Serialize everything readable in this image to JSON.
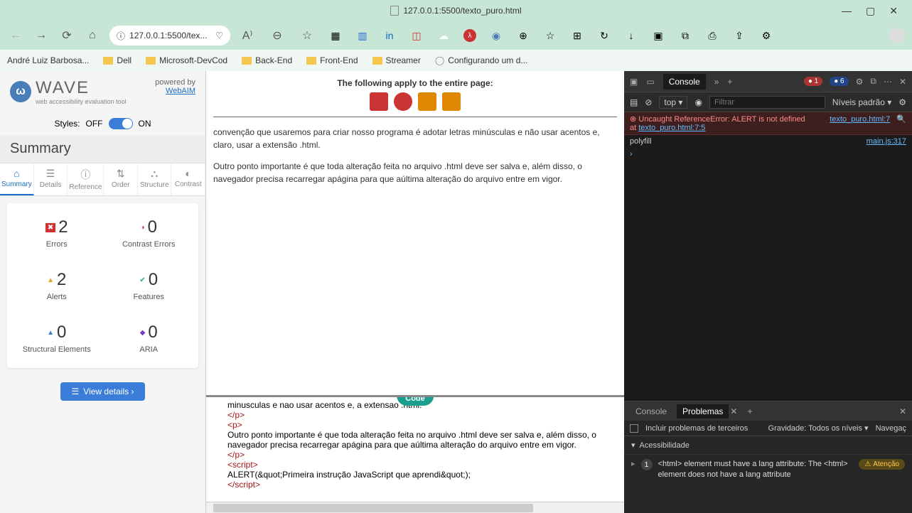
{
  "browser": {
    "tab_title": "127.0.0.1:5500/texto_puro.html",
    "address": "127.0.0.1:5500/tex...",
    "bookmarks": [
      {
        "label": "André Luiz Barbosa..."
      },
      {
        "label": "Dell"
      },
      {
        "label": "Microsoft-DevCod"
      },
      {
        "label": "Back-End"
      },
      {
        "label": "Front-End"
      },
      {
        "label": "Streamer"
      },
      {
        "label": "Configurando um d..."
      }
    ]
  },
  "wave": {
    "brand": "WAVE",
    "tagline": "web accessibility evaluation tool",
    "powered": "powered by",
    "powered_link": "WebAIM",
    "styles_label": "Styles:",
    "off": "OFF",
    "on": "ON",
    "summary": "Summary",
    "tabs": [
      "Summary",
      "Details",
      "Reference",
      "Order",
      "Structure",
      "Contrast"
    ],
    "stats": {
      "errors": {
        "n": "2",
        "l": "Errors",
        "color": "#c33",
        "glyph": "✖"
      },
      "contrast": {
        "n": "0",
        "l": "Contrast Errors",
        "color": "#c33",
        "glyph": "◑"
      },
      "alerts": {
        "n": "2",
        "l": "Alerts",
        "color": "#e6a817",
        "glyph": "▲"
      },
      "features": {
        "n": "0",
        "l": "Features",
        "color": "#2a7",
        "glyph": "✔"
      },
      "structural": {
        "n": "0",
        "l": "Structural Elements",
        "color": "#3b7dd8",
        "glyph": "▲"
      },
      "aria": {
        "n": "0",
        "l": "ARIA",
        "color": "#7a3bb8",
        "glyph": "◆"
      }
    },
    "view_details": "View details ›"
  },
  "page": {
    "banner": "The following apply to the entire page:",
    "p1": "convenção que usaremos para criar nosso programa é adotar letras minúsculas e não usar acentos e, claro, usar a extensão .html.",
    "p2": "Outro ponto importante é que toda alteração feita no arquivo .html deve ser salva e, além disso, o navegador precisa recarregar apágina para que aúltima alteração do arquivo entre em vigor."
  },
  "code": {
    "badge_top": "</>",
    "badge": "Code",
    "l1a": "minusculas e nao usar acentos e,",
    "l1b": " a extensao .ntml.",
    "l2": "</p>",
    "l3": "<p>",
    "l4": " Outro ponto importante é que toda alteração feita no arquivo .html deve ser salva e, além disso, o navegador precisa recarregar apágina para que aúltima alteração do arquivo entre em vigor.",
    "l5": "</p>",
    "l6": "<script>",
    "l7": " ALERT(&quot;Primeira instrução JavaScript que aprendi&quot;);",
    "l8": "</scr"
  },
  "devtools": {
    "tab_console": "Console",
    "err_badge": "1",
    "info_badge": "6",
    "context": "top",
    "filter_ph": "Filtrar",
    "levels": "Níveis padrão",
    "err_msg": "Uncaught ReferenceError: ALERT is not defined",
    "err_at": "    at ",
    "err_at_link": "texto_puro.html:7:5",
    "err_link": "texto_puro.html:7",
    "poly": "polyfill",
    "poly_link": "main.js:317",
    "bottom": {
      "console": "Console",
      "problemas": "Problemas",
      "include": "Incluir problemas de terceiros",
      "gravity": "Gravidade: Todos os níveis",
      "nav": "Navegaç",
      "section": "Acessibilidade",
      "count": "1",
      "msg": "<html> element must have a lang attribute: The <html> element does not have a lang attribute",
      "warn": "Atenção"
    }
  }
}
